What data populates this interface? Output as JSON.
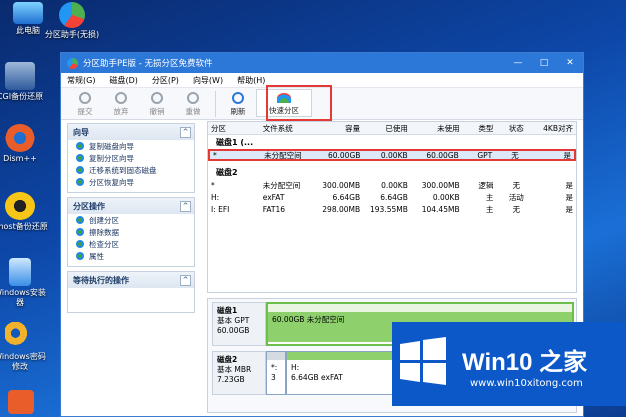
{
  "desktop": {
    "icons": [
      {
        "label": "此电脑"
      },
      {
        "label": "分区助手(无损)"
      },
      {
        "label": "CGI备份还原"
      },
      {
        "label": "Dism++"
      },
      {
        "label": "Ghost备份还原"
      },
      {
        "label": "Windows安装器"
      },
      {
        "label": "Windows密码修改"
      }
    ]
  },
  "window": {
    "title": "分区助手PE版 - 无损分区免费软件",
    "controls": {
      "minimize": "—",
      "maximize": "□",
      "close": "✕"
    },
    "menu": [
      "常规(G)",
      "磁盘(D)",
      "分区(P)",
      "向导(W)",
      "帮助(H)"
    ],
    "toolbar": {
      "submit": "提交",
      "discard": "放弃",
      "undo": "撤销",
      "redo": "重做",
      "refresh": "刷新",
      "quick_partition": "快速分区"
    }
  },
  "left_panel": {
    "wizard": {
      "title": "向导",
      "items": [
        "复制磁盘向导",
        "复制分区向导",
        "迁移系统到固态磁盘",
        "分区恢复向导"
      ]
    },
    "partition_ops": {
      "title": "分区操作",
      "items": [
        "创建分区",
        "擦除数据",
        "检查分区",
        "属性"
      ]
    },
    "pending": {
      "title": "等待执行的操作"
    }
  },
  "table": {
    "headers": [
      "分区",
      "文件系统",
      "容量",
      "已使用",
      "未使用",
      "类型",
      "状态",
      "4KB对齐"
    ],
    "disk1": {
      "title": "磁盘1 (...",
      "rows": [
        [
          "*",
          "未分配空间",
          "60.00GB",
          "0.00KB",
          "60.00GB",
          "GPT",
          "无",
          "是"
        ]
      ]
    },
    "disk2": {
      "title": "磁盘2",
      "rows": [
        [
          "*",
          "未分配空间",
          "300.00MB",
          "0.00KB",
          "300.00MB",
          "逻辑",
          "无",
          "是"
        ],
        [
          "H:",
          "exFAT",
          "6.64GB",
          "6.64GB",
          "0.00KB",
          "主",
          "活动",
          "是"
        ],
        [
          "I: EFI",
          "FAT16",
          "298.00MB",
          "193.55MB",
          "104.45MB",
          "主",
          "无",
          "是"
        ]
      ]
    }
  },
  "diskmap": {
    "disk1": {
      "name": "磁盘1",
      "type": "基本 GPT",
      "size": "60.00GB",
      "part_text": "60.00GB 未分配空间"
    },
    "disk2": {
      "name": "磁盘2",
      "type": "基本 MBR",
      "size": "7.23GB",
      "part1": "*:",
      "part1_sub": "3",
      "part2_name": "H:",
      "part2_text": "6.64GB exFAT"
    }
  },
  "watermark": {
    "brand": "Win10 之家",
    "url": "www.win10xitong.com"
  }
}
